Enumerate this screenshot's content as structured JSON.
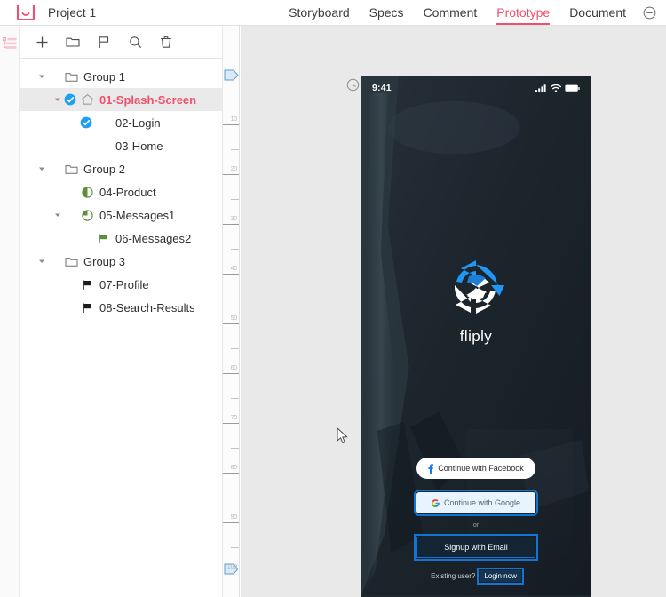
{
  "topbar": {
    "logo_icon": "mockplus-logo-icon",
    "project_name": "Project 1",
    "nav_items": [
      {
        "label": "Storyboard",
        "active": false
      },
      {
        "label": "Specs",
        "active": false
      },
      {
        "label": "Comment",
        "active": false
      },
      {
        "label": "Prototype",
        "active": true
      },
      {
        "label": "Document",
        "active": false
      }
    ],
    "collapse_icon": "circle-minus-icon",
    "accent_color": "#f0506e"
  },
  "rail": {
    "icon": "outline-list-icon"
  },
  "sidebar": {
    "toolbar": [
      {
        "name": "add-page-button",
        "icon": "plus-icon"
      },
      {
        "name": "add-folder-button",
        "icon": "folder-icon"
      },
      {
        "name": "add-flag-button",
        "icon": "flag-icon"
      },
      {
        "name": "search-button",
        "icon": "search-icon"
      },
      {
        "name": "delete-button",
        "icon": "trash-icon"
      }
    ],
    "tree": [
      {
        "label": "Group 1",
        "indent": 0,
        "icon": "folder-open-icon",
        "twisty": "down",
        "check": false,
        "selected": false
      },
      {
        "label": "01-Splash-Screen",
        "indent": 1,
        "icon": "home-icon",
        "twisty": "down",
        "check": true,
        "selected": true
      },
      {
        "label": "02-Login",
        "indent": 2,
        "icon": "none",
        "twisty": "none",
        "check": true,
        "selected": false
      },
      {
        "label": "03-Home",
        "indent": 2,
        "icon": "none",
        "twisty": "none",
        "check": false,
        "selected": false
      },
      {
        "label": "Group 2",
        "indent": 0,
        "icon": "folder-open-icon",
        "twisty": "down",
        "check": false,
        "selected": false
      },
      {
        "label": "04-Product",
        "indent": 1,
        "icon": "half-circle-green-icon",
        "twisty": "none",
        "check": false,
        "selected": false
      },
      {
        "label": "05-Messages1",
        "indent": 1,
        "icon": "quarter-circle-green-icon",
        "twisty": "down",
        "check": false,
        "selected": false
      },
      {
        "label": "06-Messages2",
        "indent": 2,
        "icon": "flag-green-icon",
        "twisty": "none",
        "check": false,
        "selected": false
      },
      {
        "label": "Group 3",
        "indent": 0,
        "icon": "folder-open-icon",
        "twisty": "down",
        "check": false,
        "selected": false
      },
      {
        "label": "07-Profile",
        "indent": 1,
        "icon": "flag-black-icon",
        "twisty": "none",
        "check": false,
        "selected": false
      },
      {
        "label": "08-Search-Results",
        "indent": 1,
        "icon": "flag-black-icon",
        "twisty": "none",
        "check": false,
        "selected": false
      }
    ]
  },
  "ruler": {
    "labels": [
      "10",
      "20",
      "30",
      "40",
      "50",
      "60",
      "70",
      "80",
      "90",
      "100"
    ],
    "markers": [
      "link-marker-top",
      "link-marker-bottom"
    ]
  },
  "canvas": {
    "clock_icon": "clock-icon",
    "cursor_icon": "mouse-pointer-icon"
  },
  "phone": {
    "statusbar": {
      "time": "9:41",
      "signal_icon": "cellular-signal-icon",
      "wifi_icon": "wifi-icon",
      "battery_icon": "battery-icon"
    },
    "logo": {
      "icon": "fliply-refresh-logo-icon",
      "text": "fliply"
    },
    "buttons": {
      "facebook": {
        "label": "Continue with Facebook",
        "icon": "facebook-f-icon",
        "hotspot": false
      },
      "google": {
        "label": "Continue with Google",
        "icon": "google-g-icon",
        "hotspot": true
      },
      "or": "or",
      "email": {
        "label": "Signup with Email",
        "hotspot": true
      }
    },
    "existing": {
      "prompt": "Existing user?",
      "link": "Login now",
      "hotspot": true
    },
    "hotspot_color": "#1274d4"
  }
}
